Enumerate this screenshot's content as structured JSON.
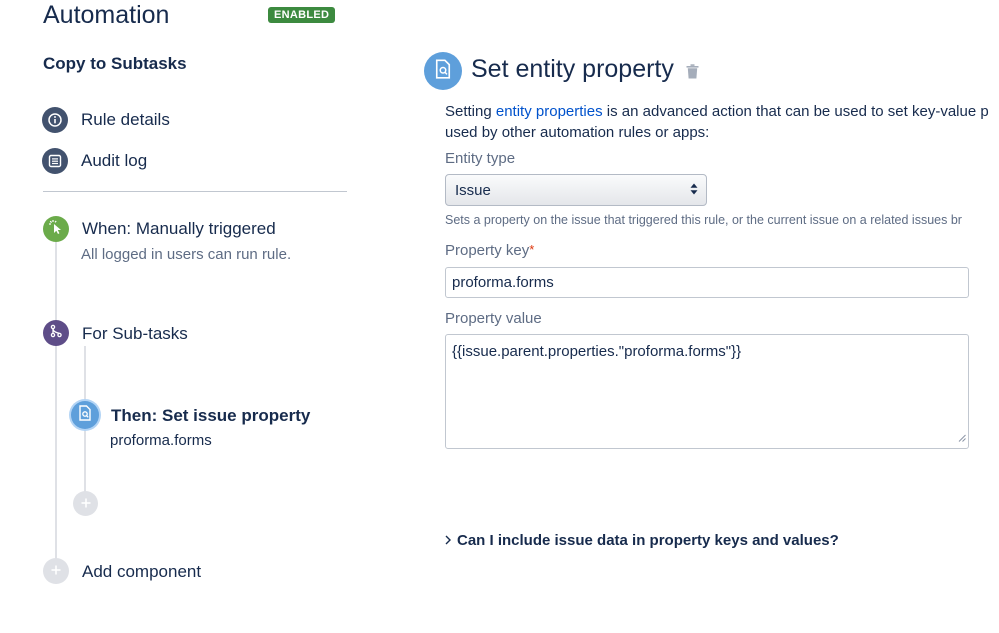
{
  "app": {
    "title": "Automation",
    "status_badge": "ENABLED"
  },
  "sidebar": {
    "rule_name": "Copy to Subtasks",
    "nav": [
      {
        "label": "Rule details",
        "icon": "info-icon"
      },
      {
        "label": "Audit log",
        "icon": "list-icon"
      }
    ],
    "trigger": {
      "title": "When: Manually triggered",
      "subtitle": "All logged in users can run rule.",
      "icon": "cursor-click-icon",
      "color": "#6bab4a"
    },
    "branch": {
      "title": "For Sub-tasks",
      "icon": "branch-icon",
      "color": "#5e4d88"
    },
    "action": {
      "title": "Then: Set issue property",
      "subtitle": "proforma.forms",
      "icon": "document-icon",
      "color": "#5e9fdb"
    },
    "add_component_label": "Add component"
  },
  "panel": {
    "title": "Set entity property",
    "description_prefix": "Setting ",
    "description_link": "entity properties",
    "description_suffix": " is an advanced action that can be used to set key-value p",
    "description_line2": "used by other automation rules or apps:",
    "entity_type": {
      "label": "Entity type",
      "value": "Issue",
      "help": "Sets a property on the issue that triggered this rule, or the current issue on a related issues br"
    },
    "property_key": {
      "label": "Property key",
      "required_mark": "*",
      "value": "proforma.forms"
    },
    "property_value": {
      "label": "Property value",
      "value": "{{issue.parent.properties.\"proforma.forms\"}}"
    },
    "faq": "Can I include issue data in property keys and values?"
  },
  "colors": {
    "accent": "#0052cc",
    "enabled": "#3c8a3f",
    "text": "#172b4d",
    "muted": "#5e6c84"
  }
}
